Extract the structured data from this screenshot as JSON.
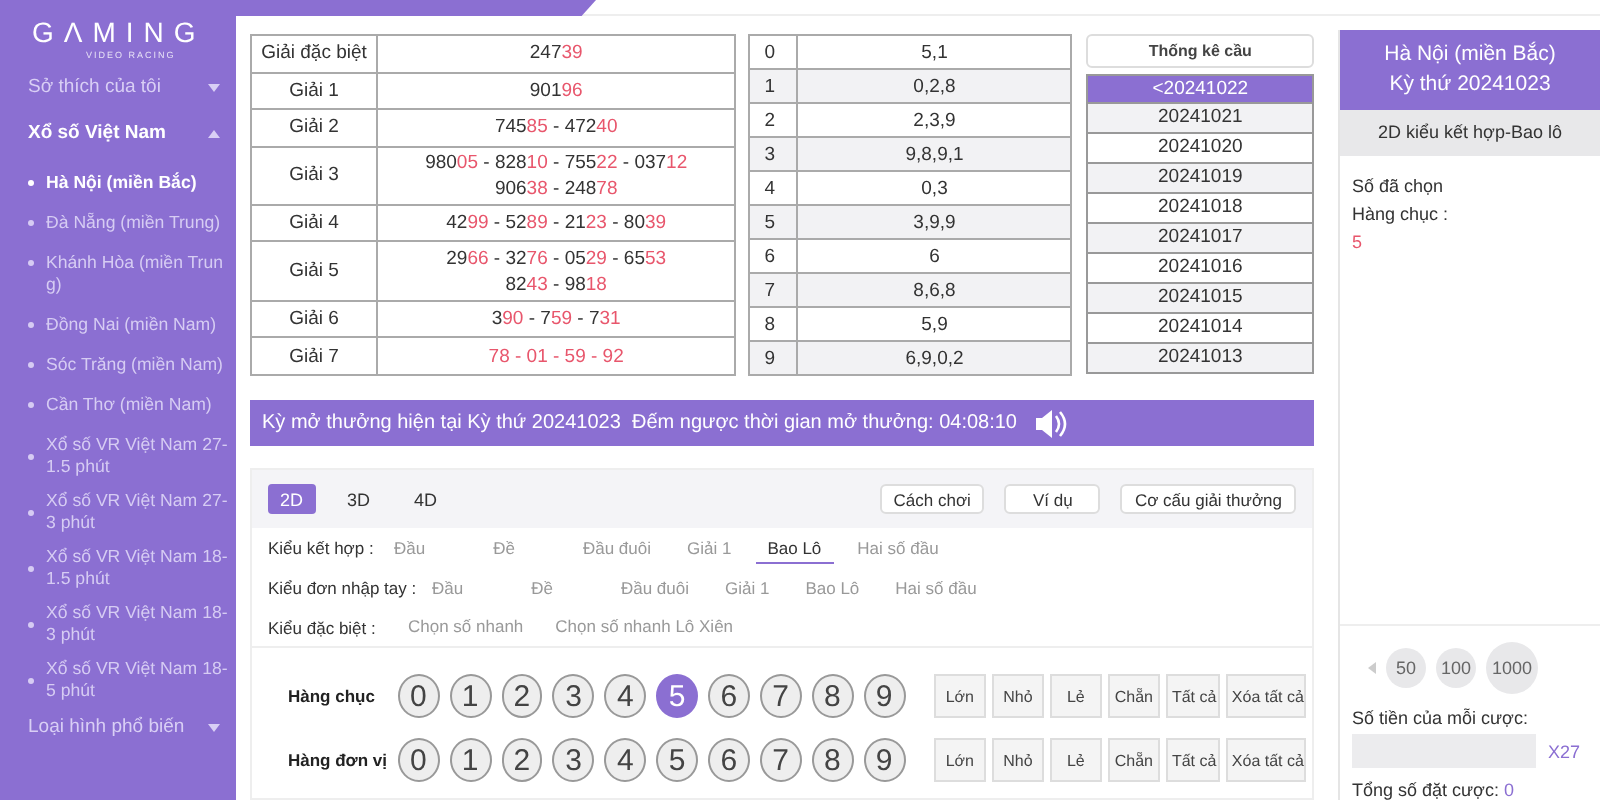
{
  "sidebar": {
    "logo": "GΛMING",
    "logo_sub": "VIDEO RACING",
    "groups": [
      {
        "label": "Sở thích của tôi",
        "expanded": false
      },
      {
        "label": "Xổ số Việt Nam",
        "expanded": true,
        "children": [
          {
            "label": "Hà Nội (miền Bắc)",
            "selected": true
          },
          {
            "label": "Đà Nẵng (miền Trung)",
            "selected": false
          },
          {
            "label": "Khánh Hòa (miền Trung)",
            "selected": false
          },
          {
            "label": "Đồng Nai (miền Nam)",
            "selected": false
          },
          {
            "label": "Sóc Trăng (miền Nam)",
            "selected": false
          },
          {
            "label": "Cần Thơ (miền Nam)",
            "selected": false
          },
          {
            "label": "Xổ số VR Việt Nam 27-1.5 phút",
            "selected": false
          },
          {
            "label": "Xổ số VR Việt Nam 27-3 phút",
            "selected": false
          },
          {
            "label": "Xổ số VR Việt Nam 18-1.5 phút",
            "selected": false
          },
          {
            "label": "Xổ số VR Việt Nam 18-3 phút",
            "selected": false
          },
          {
            "label": "Xổ số VR Việt Nam 18-5 phút",
            "selected": false
          }
        ]
      },
      {
        "label": "Loại hình phổ biến",
        "expanded": false
      }
    ]
  },
  "prizes": [
    {
      "name": "Giải đặc biệt",
      "lines": [
        [
          {
            "text": "247",
            "hot": false
          },
          {
            "text": "39",
            "hot": true
          }
        ]
      ]
    },
    {
      "name": "Giải 1",
      "lines": [
        [
          {
            "text": "901",
            "hot": false
          },
          {
            "text": "96",
            "hot": true
          }
        ]
      ]
    },
    {
      "name": "Giải 2",
      "lines": [
        [
          {
            "text": "745",
            "hot": false
          },
          {
            "text": "85",
            "hot": true
          },
          {
            "text": " - 472",
            "hot": false
          },
          {
            "text": "40",
            "hot": true
          }
        ]
      ]
    },
    {
      "name": "Giải 3",
      "lines": [
        [
          {
            "text": "980",
            "hot": false
          },
          {
            "text": "05",
            "hot": true
          },
          {
            "text": " - 828",
            "hot": false
          },
          {
            "text": "10",
            "hot": true
          },
          {
            "text": " - 755",
            "hot": false
          },
          {
            "text": "22",
            "hot": true
          },
          {
            "text": " - 037",
            "hot": false
          },
          {
            "text": "12",
            "hot": true
          }
        ],
        [
          {
            "text": "906",
            "hot": false
          },
          {
            "text": "38",
            "hot": true
          },
          {
            "text": " - 248",
            "hot": false
          },
          {
            "text": "78",
            "hot": true
          }
        ]
      ]
    },
    {
      "name": "Giải 4",
      "lines": [
        [
          {
            "text": "42",
            "hot": false
          },
          {
            "text": "99",
            "hot": true
          },
          {
            "text": " - 52",
            "hot": false
          },
          {
            "text": "89",
            "hot": true
          },
          {
            "text": " - 21",
            "hot": false
          },
          {
            "text": "23",
            "hot": true
          },
          {
            "text": " - 80",
            "hot": false
          },
          {
            "text": "39",
            "hot": true
          }
        ]
      ]
    },
    {
      "name": "Giải 5",
      "lines": [
        [
          {
            "text": "29",
            "hot": false
          },
          {
            "text": "66",
            "hot": true
          },
          {
            "text": " - 32",
            "hot": false
          },
          {
            "text": "76",
            "hot": true
          },
          {
            "text": " - 05",
            "hot": false
          },
          {
            "text": "29",
            "hot": true
          },
          {
            "text": " - 65",
            "hot": false
          },
          {
            "text": "53",
            "hot": true
          }
        ],
        [
          {
            "text": "82",
            "hot": false
          },
          {
            "text": "43",
            "hot": true
          },
          {
            "text": " - 98",
            "hot": false
          },
          {
            "text": "18",
            "hot": true
          }
        ]
      ]
    },
    {
      "name": "Giải 6",
      "lines": [
        [
          {
            "text": "3",
            "hot": false
          },
          {
            "text": "90",
            "hot": true
          },
          {
            "text": " - 7",
            "hot": false
          },
          {
            "text": "59",
            "hot": true
          },
          {
            "text": " - 7",
            "hot": false
          },
          {
            "text": "31",
            "hot": true
          }
        ]
      ]
    },
    {
      "name": "Giải 7",
      "lines": [
        [
          {
            "text": "78 - 01 - 59 - 92",
            "hot": true
          }
        ]
      ]
    }
  ],
  "head_tail": [
    {
      "digit": "0",
      "values": "5,1"
    },
    {
      "digit": "1",
      "values": "0,2,8"
    },
    {
      "digit": "2",
      "values": "2,3,9"
    },
    {
      "digit": "3",
      "values": "9,8,9,1"
    },
    {
      "digit": "4",
      "values": "0,3"
    },
    {
      "digit": "5",
      "values": "3,9,9"
    },
    {
      "digit": "6",
      "values": "6"
    },
    {
      "digit": "7",
      "values": "8,6,8"
    },
    {
      "digit": "8",
      "values": "5,9"
    },
    {
      "digit": "9",
      "values": "6,9,0,2"
    }
  ],
  "stats_button": "Thống kê cầu",
  "draws": [
    {
      "label": "<20241022",
      "selected": true
    },
    {
      "label": "20241021",
      "selected": false
    },
    {
      "label": "20241020",
      "selected": false
    },
    {
      "label": "20241019",
      "selected": false
    },
    {
      "label": "20241018",
      "selected": false
    },
    {
      "label": "20241017",
      "selected": false
    },
    {
      "label": "20241016",
      "selected": false
    },
    {
      "label": "20241015",
      "selected": false
    },
    {
      "label": "20241014",
      "selected": false
    },
    {
      "label": "20241013",
      "selected": false
    }
  ],
  "banner": {
    "current": "Kỳ mở thưởng hiện tại Kỳ thứ 20241023",
    "countdown": "Đếm ngược thời gian mở thưởng: 04:08:10"
  },
  "game_tabs": [
    {
      "label": "2D",
      "selected": true
    },
    {
      "label": "3D",
      "selected": false
    },
    {
      "label": "4D",
      "selected": false
    }
  ],
  "help_buttons": [
    "Cách chơi",
    "Ví dụ",
    "Cơ cấu giải thưởng"
  ],
  "bet_types": [
    {
      "label": "Kiểu kết hợp :",
      "options": [
        {
          "label": "Đầu",
          "selected": false
        },
        {
          "label": "Đề",
          "selected": false
        },
        {
          "label": "Đầu đuôi",
          "selected": false
        },
        {
          "label": "Giải 1",
          "selected": false
        },
        {
          "label": "Bao Lô",
          "selected": true
        },
        {
          "label": "Hai số đầu",
          "selected": false
        }
      ]
    },
    {
      "label": "Kiểu đơn nhập tay :",
      "options": [
        {
          "label": "Đầu",
          "selected": false
        },
        {
          "label": "Đề",
          "selected": false
        },
        {
          "label": "Đầu đuôi",
          "selected": false
        },
        {
          "label": "Giải 1",
          "selected": false
        },
        {
          "label": "Bao Lô",
          "selected": false
        },
        {
          "label": "Hai số đầu",
          "selected": false
        }
      ]
    },
    {
      "label": "Kiểu đặc biệt :",
      "options": [
        {
          "label": "Chọn số nhanh",
          "selected": false
        },
        {
          "label": "Chọn số nhanh Lô Xiên",
          "selected": false
        }
      ]
    }
  ],
  "pickers": [
    {
      "label": "Hàng chục",
      "digits": [
        {
          "label": "0",
          "selected": false
        },
        {
          "label": "1",
          "selected": false
        },
        {
          "label": "2",
          "selected": false
        },
        {
          "label": "3",
          "selected": false
        },
        {
          "label": "4",
          "selected": false
        },
        {
          "label": "5",
          "selected": true
        },
        {
          "label": "6",
          "selected": false
        },
        {
          "label": "7",
          "selected": false
        },
        {
          "label": "8",
          "selected": false
        },
        {
          "label": "9",
          "selected": false
        }
      ],
      "quick": [
        "Lớn",
        "Nhỏ",
        "Lẻ",
        "Chẵn",
        "Tất cả",
        "Xóa tất cả"
      ]
    },
    {
      "label": "Hàng đơn vị",
      "digits": [
        {
          "label": "0",
          "selected": false
        },
        {
          "label": "1",
          "selected": false
        },
        {
          "label": "2",
          "selected": false
        },
        {
          "label": "3",
          "selected": false
        },
        {
          "label": "4",
          "selected": false
        },
        {
          "label": "5",
          "selected": false
        },
        {
          "label": "6",
          "selected": false
        },
        {
          "label": "7",
          "selected": false
        },
        {
          "label": "8",
          "selected": false
        },
        {
          "label": "9",
          "selected": false
        }
      ],
      "quick": [
        "Lớn",
        "Nhỏ",
        "Lẻ",
        "Chẵn",
        "Tất cả",
        "Xóa tất cả"
      ]
    }
  ],
  "slip": {
    "region": "Hà Nội (miền Bắc)",
    "period": "Kỳ thứ 20241023",
    "mode": "2D kiểu kết hợp-Bao lô",
    "picked_title": "Số đã chọn",
    "picked_label": "Hàng chục :",
    "picked_value": "5",
    "chips": [
      "50",
      "100",
      "1000"
    ],
    "amount_label": "Số tiền của mỗi cược:",
    "multiplier": "X27",
    "total_label": "Tổng số đặt cược:",
    "total_value": "0"
  }
}
